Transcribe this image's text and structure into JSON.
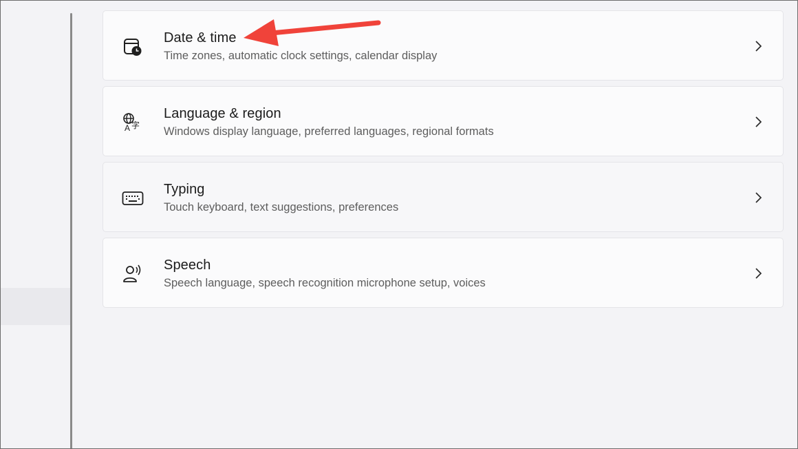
{
  "settings_list": [
    {
      "id": "date-time",
      "title": "Date & time",
      "subtitle": "Time zones, automatic clock settings, calendar display",
      "icon": "calendar-clock-icon"
    },
    {
      "id": "language-region",
      "title": "Language & region",
      "subtitle": "Windows display language, preferred languages, regional formats",
      "icon": "language-icon"
    },
    {
      "id": "typing",
      "title": "Typing",
      "subtitle": "Touch keyboard, text suggestions, preferences",
      "icon": "keyboard-icon"
    },
    {
      "id": "speech",
      "title": "Speech",
      "subtitle": "Speech language, speech recognition microphone setup, voices",
      "icon": "speech-icon"
    }
  ],
  "annotation": {
    "color": "#f0433a",
    "target": "date-time"
  }
}
